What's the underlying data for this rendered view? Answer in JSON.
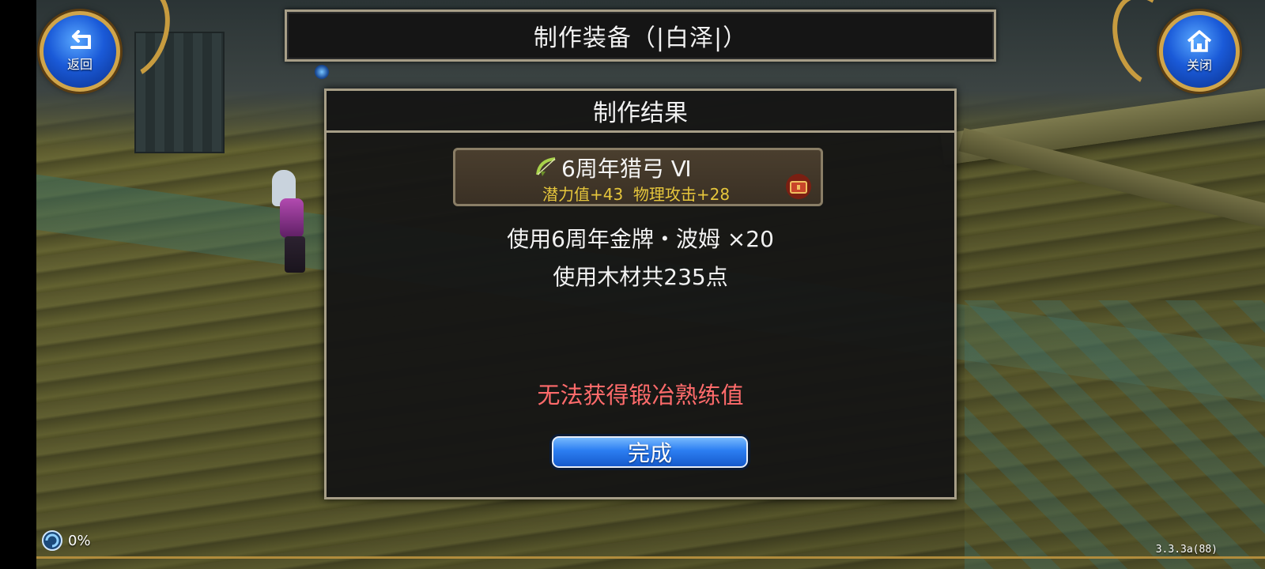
{
  "header": {
    "back_label": "返回",
    "close_label": "关闭",
    "title": "制作装备（|白泽|）"
  },
  "dialog": {
    "title": "制作结果",
    "item": {
      "name": "6周年猎弓 Ⅵ",
      "stats": "潜力值+43  物理攻击+28",
      "icon": "bow-icon",
      "side_icon": "treasure-chest-icon"
    },
    "material_line": "使用6周年金牌・波姆 ×20",
    "wood_line": "使用木材共235点",
    "warning": "无法获得锻冶熟练值",
    "done_label": "完成"
  },
  "status": {
    "progress_text": "0%",
    "version": "3.3.3a(88)"
  },
  "colors": {
    "warning": "#ff6b6b",
    "stats": "#e6c63c",
    "frame": "#a79e87",
    "button_blue": "#2c7ef2"
  }
}
